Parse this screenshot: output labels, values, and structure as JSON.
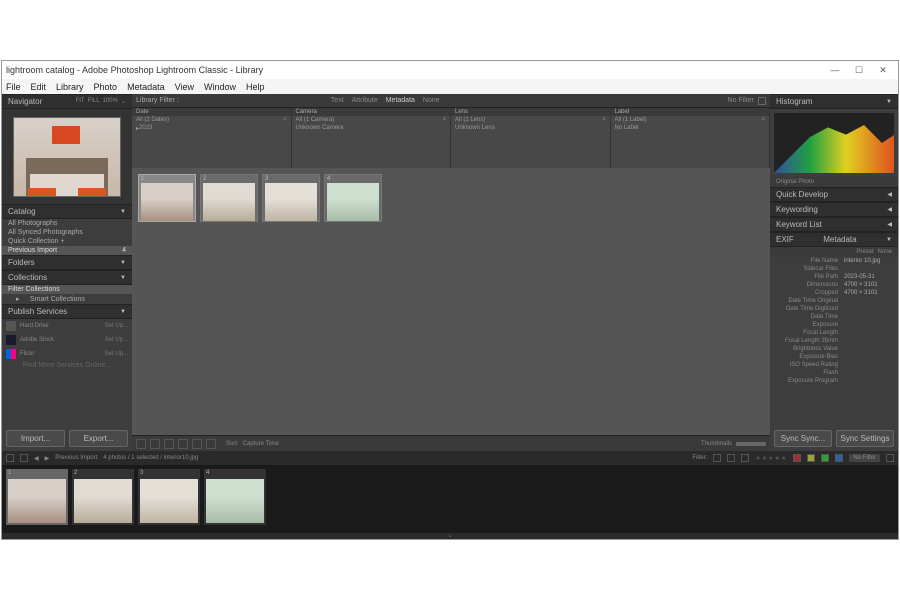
{
  "window": {
    "title": "lightroom catalog - Adobe Photoshop Lightroom Classic - Library",
    "min": "—",
    "max": "☐",
    "close": "✕"
  },
  "menu": [
    "File",
    "Edit",
    "Library",
    "Photo",
    "Metadata",
    "View",
    "Window",
    "Help"
  ],
  "navigator": {
    "title": "Navigator",
    "opts": [
      "FIT",
      "FILL",
      "100%",
      "⌄"
    ]
  },
  "left_panels": {
    "catalog": {
      "title": "Catalog",
      "items": [
        "All Photographs",
        "All Synced Photographs",
        "Quick Collection  +",
        "Previous Import"
      ]
    },
    "folders": {
      "title": "Folders"
    },
    "collections": {
      "title": "Collections",
      "items": [
        "Filter Collections",
        "Smart Collections"
      ]
    },
    "publish": {
      "title": "Publish Services",
      "items": [
        {
          "name": "Hard Drive",
          "setup": "Set Up..."
        },
        {
          "name": "Adobe Stock",
          "setup": "Set Up..."
        },
        {
          "name": "Flickr",
          "setup": "Set Up..."
        }
      ],
      "find_more": "Find More Services Online..."
    },
    "import_btn": "Import...",
    "export_btn": "Export..."
  },
  "filter_bar": {
    "label": "Library Filter :",
    "tabs": [
      "Text",
      "Attribute",
      "Metadata",
      "None"
    ],
    "active": "Metadata",
    "preset": "No Filter"
  },
  "meta_filter": {
    "cols": [
      {
        "hdr": "Date",
        "rows": [
          {
            "t": "All (2 Dates)",
            "c": "4"
          },
          {
            "t": "2023",
            "c": ""
          }
        ]
      },
      {
        "hdr": "Camera",
        "rows": [
          {
            "t": "All (1 Camera)",
            "c": "4"
          },
          {
            "t": "Unknown Camera",
            "c": ""
          }
        ]
      },
      {
        "hdr": "Lens",
        "rows": [
          {
            "t": "All (1 Lens)",
            "c": "4"
          },
          {
            "t": "Unknown Lens",
            "c": ""
          }
        ]
      },
      {
        "hdr": "Label",
        "rows": [
          {
            "t": "All (1 Label)",
            "c": "4"
          },
          {
            "t": "No Label",
            "c": ""
          }
        ]
      }
    ]
  },
  "grid": {
    "thumbs": [
      1,
      2,
      3,
      4
    ],
    "selected": 1
  },
  "toolbar": {
    "sort_label": "Sort:",
    "sort_value": "Capture Time",
    "thumbnails": "Thumbnails"
  },
  "right": {
    "histogram": "Histogram",
    "original": "Original Photo",
    "quick_develop": "Quick Develop",
    "keywording": "Keywording",
    "keyword_list": "Keyword List",
    "metadata": "Metadata",
    "exif_label": "EXIF",
    "preset_label": "Preset",
    "preset_value": "None",
    "fields": [
      {
        "k": "File Name",
        "v": "interior 10.jpg"
      },
      {
        "k": "Sidecar Files",
        "v": ""
      },
      {
        "k": "File Path",
        "v": "2023-05-31"
      },
      {
        "k": "Dimensions",
        "v": "4700 × 3101"
      },
      {
        "k": "Cropped",
        "v": "4700 × 3101"
      },
      {
        "k": "Date Time Original",
        "v": ""
      },
      {
        "k": "Date Time Digitized",
        "v": ""
      },
      {
        "k": "Date Time",
        "v": ""
      },
      {
        "k": "Exposure",
        "v": ""
      },
      {
        "k": "Focal Length",
        "v": ""
      },
      {
        "k": "Focal Length 35mm",
        "v": ""
      },
      {
        "k": "Brightness Value",
        "v": ""
      },
      {
        "k": "Exposure Bias",
        "v": ""
      },
      {
        "k": "ISO Speed Rating",
        "v": ""
      },
      {
        "k": "Flash",
        "v": ""
      },
      {
        "k": "Exposure Program",
        "v": ""
      }
    ],
    "sync_btn": "Sync Sync...",
    "settings_btn": "Sync Settings"
  },
  "filmstrip_bar": {
    "breadcrumb": "Previous Import",
    "count": "4 photos / 1 selected / interior10.jpg",
    "filter_label": "Filter:",
    "no_filter": "No Filter"
  },
  "filmstrip": {
    "thumbs": [
      1,
      2,
      3,
      4
    ],
    "selected": 1
  }
}
